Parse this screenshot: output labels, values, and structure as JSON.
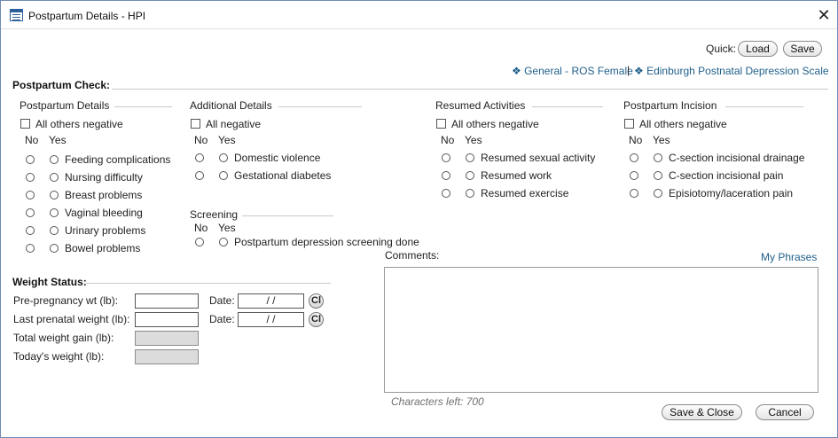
{
  "window": {
    "title": "Postpartum Details - HPI",
    "close_label": "✕"
  },
  "toolbar": {
    "quick_label": "Quick:",
    "load_label": "Load",
    "save_label": "Save"
  },
  "links": {
    "general_ros": "❖ General - ROS Female",
    "separator": "|",
    "edinburgh": "❖ Edinburgh Postnatal Depression Scale"
  },
  "postpartum_check": {
    "title": "Postpartum Check:"
  },
  "postpartum_details": {
    "title": "Postpartum Details",
    "all_negative": "All others negative",
    "no": "No",
    "yes": "Yes",
    "items": [
      "Feeding complications",
      "Nursing difficulty",
      "Breast problems",
      "Vaginal bleeding",
      "Urinary problems",
      "Bowel problems"
    ]
  },
  "additional_details": {
    "title": "Additional Details",
    "all_negative": "All negative",
    "no": "No",
    "yes": "Yes",
    "items": [
      "Domestic violence",
      "Gestational diabetes"
    ]
  },
  "screening": {
    "title": "Screening",
    "no": "No",
    "yes": "Yes",
    "items": [
      "Postpartum depression screening done"
    ]
  },
  "resumed_activities": {
    "title": "Resumed Activities",
    "all_negative": "All others negative",
    "no": "No",
    "yes": "Yes",
    "items": [
      "Resumed sexual activity",
      "Resumed work",
      "Resumed exercise"
    ]
  },
  "postpartum_incision": {
    "title": "Postpartum Incision",
    "all_negative": "All others negative",
    "no": "No",
    "yes": "Yes",
    "items": [
      "C-section incisional drainage",
      "C-section incisional pain",
      "Episiotomy/laceration pain"
    ]
  },
  "weight_status": {
    "title": "Weight Status:",
    "pre_pregnancy_label": "Pre-pregnancy wt (lb):",
    "last_prenatal_label": "Last prenatal weight (lb):",
    "total_gain_label": "Total weight gain (lb):",
    "todays_weight_label": "Today's weight (lb):",
    "date_label": "Date:",
    "date_placeholder": " /  / ",
    "clear_label": "Cl"
  },
  "comments": {
    "label": "Comments:",
    "my_phrases": "My Phrases",
    "chars_left": "Characters left: 700"
  },
  "footer": {
    "save_close_label": "Save & Close",
    "cancel_label": "Cancel"
  }
}
